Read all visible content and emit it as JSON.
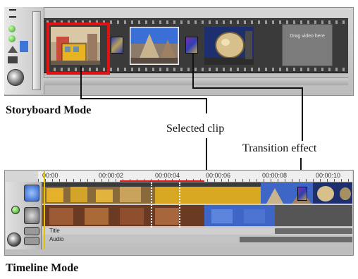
{
  "labels": {
    "storyboard_mode": "Storyboard Mode",
    "selected_clip": "Selected clip",
    "transition_effect": "Transition effect",
    "timeline_mode": "Timeline Mode"
  },
  "storyboard": {
    "empty_slot_text": "Drag video here",
    "clips": [
      {
        "name": "tram",
        "selected": true
      },
      {
        "name": "street"
      },
      {
        "name": "stone-sculpture"
      }
    ],
    "transitions": [
      "transition-1",
      "transition-2"
    ]
  },
  "timeline": {
    "ruler_labels": [
      "00:00",
      "00:00:02",
      "00:00:04",
      "00:00:06",
      "00:00:08",
      "00:00:10"
    ],
    "track_labels": [
      "Title",
      "Audio"
    ]
  },
  "colors": {
    "selection": "#e01212",
    "playhead": "#e3c200",
    "range": "#e01818"
  }
}
